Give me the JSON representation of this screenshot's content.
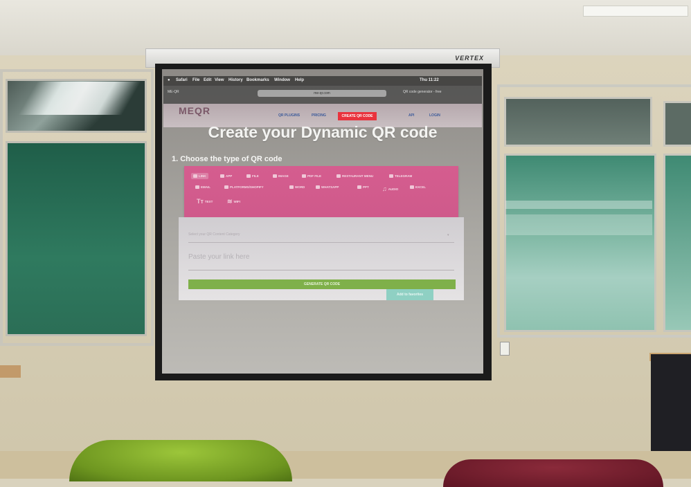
{
  "projector": {
    "brand": "VERTEX"
  },
  "mac_menubar": {
    "apple": "",
    "items": [
      "Safari",
      "File",
      "Edit",
      "View",
      "History",
      "Bookmarks",
      "Window",
      "Help"
    ],
    "status": "Thu 11:22"
  },
  "browser": {
    "address": "me-qr.com",
    "tabs": [
      "ME-QR",
      "QR code generator - free"
    ]
  },
  "site": {
    "logo": "MEQR",
    "nav_items": [
      "QR PLUGINS",
      "PRICING",
      "CREATE QR CODE",
      "API",
      "LOGIN"
    ],
    "heading": "Create your Dynamic QR code",
    "subheading": "1. Choose the type of QR code",
    "qr_types": [
      {
        "label": "LINK",
        "icon": "link-icon",
        "active": true
      },
      {
        "label": "APP",
        "icon": "app-icon"
      },
      {
        "label": "FILE",
        "icon": "file-icon"
      },
      {
        "label": "IMAGE",
        "icon": "image-icon"
      },
      {
        "label": "PDF FILE",
        "icon": "pdf-icon"
      },
      {
        "label": "RESTAURANT MENU",
        "icon": "menu-icon"
      },
      {
        "label": "TELEGRAM",
        "icon": "telegram-icon"
      },
      {
        "label": "EMAIL",
        "icon": "email-icon"
      },
      {
        "label": "PLATFORMS/SHOPIFY",
        "icon": "platforms-icon"
      },
      {
        "label": "WORD",
        "icon": "word-icon"
      },
      {
        "label": "WHATSAPP",
        "icon": "whatsapp-icon"
      },
      {
        "label": "PPT",
        "icon": "ppt-icon"
      },
      {
        "label": "AUDIO",
        "icon": "audio-icon"
      },
      {
        "label": "EXCEL",
        "icon": "excel-icon"
      },
      {
        "label": "TEXT",
        "icon": "text-icon"
      },
      {
        "label": "WIFI",
        "icon": "wifi-icon"
      }
    ],
    "category_placeholder": "Select your QR Content Category",
    "link_placeholder": "Paste your link here",
    "generate_label": "GENERATE QR CODE",
    "secondary_label": "Add to favorites"
  },
  "colors": {
    "pink_panel": "#d55d8f",
    "generate_green": "#7fb04a",
    "nav_red": "#e9333d",
    "mini_teal": "#8fd0c3"
  }
}
